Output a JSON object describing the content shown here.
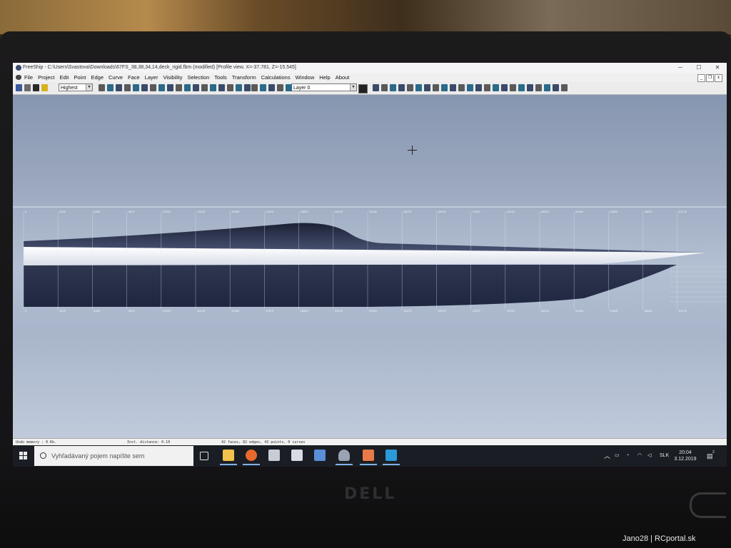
{
  "window": {
    "title": "FreeShip - C:\\Users\\Svastova\\Downloads\\67FS_38,38,34,14,deck_rigid.fbm (modified)   [Profile view.  X=-37.781,  Z=-15.545]",
    "minimize_glyph": "─",
    "maximize_glyph": "☐",
    "close_glyph": "✕"
  },
  "menubar": {
    "items": [
      "File",
      "Project",
      "Edit",
      "Point",
      "Edge",
      "Curve",
      "Face",
      "Layer",
      "Visibility",
      "Selection",
      "Tools",
      "Transform",
      "Calculations",
      "Window",
      "Help",
      "About"
    ],
    "mdi_min": "_",
    "mdi_restore": "❐",
    "mdi_close": "x"
  },
  "toolbar": {
    "precision_value": "Highest",
    "layer_value": "Layer 0",
    "active_color": "#222222"
  },
  "ruler": {
    "top_ticks": [
      "0",
      "3225",
      "6450",
      "9675",
      "12900",
      "16125",
      "19350",
      "22575",
      "25800",
      "29025",
      "32250",
      "35475",
      "38700",
      "41925",
      "45150",
      "48375",
      "51600",
      "54825",
      "58050",
      "61275"
    ],
    "bottom_ticks": [
      "0",
      "3225",
      "6450",
      "9675",
      "12900",
      "16125",
      "19350",
      "22575",
      "25800",
      "29025",
      "32250",
      "35475",
      "38700",
      "41925",
      "45150",
      "48375",
      "51600",
      "54825",
      "58050",
      "61275"
    ]
  },
  "statusbar": {
    "undo": "Undo memory : 0 Kb.",
    "distance": "Inst. distance: 0.10",
    "counts": "42 faces, 82 edges, 43 points, 0 curves"
  },
  "taskbar": {
    "search_placeholder": "Vyhľadávaný pojem napíšte sem",
    "language": "SLK",
    "time": "20:04",
    "date": "3.12.2019",
    "notification_count": "2"
  },
  "overlay": {
    "brand": "DELL",
    "watermark": "Jano28 | RCportal.sk"
  }
}
